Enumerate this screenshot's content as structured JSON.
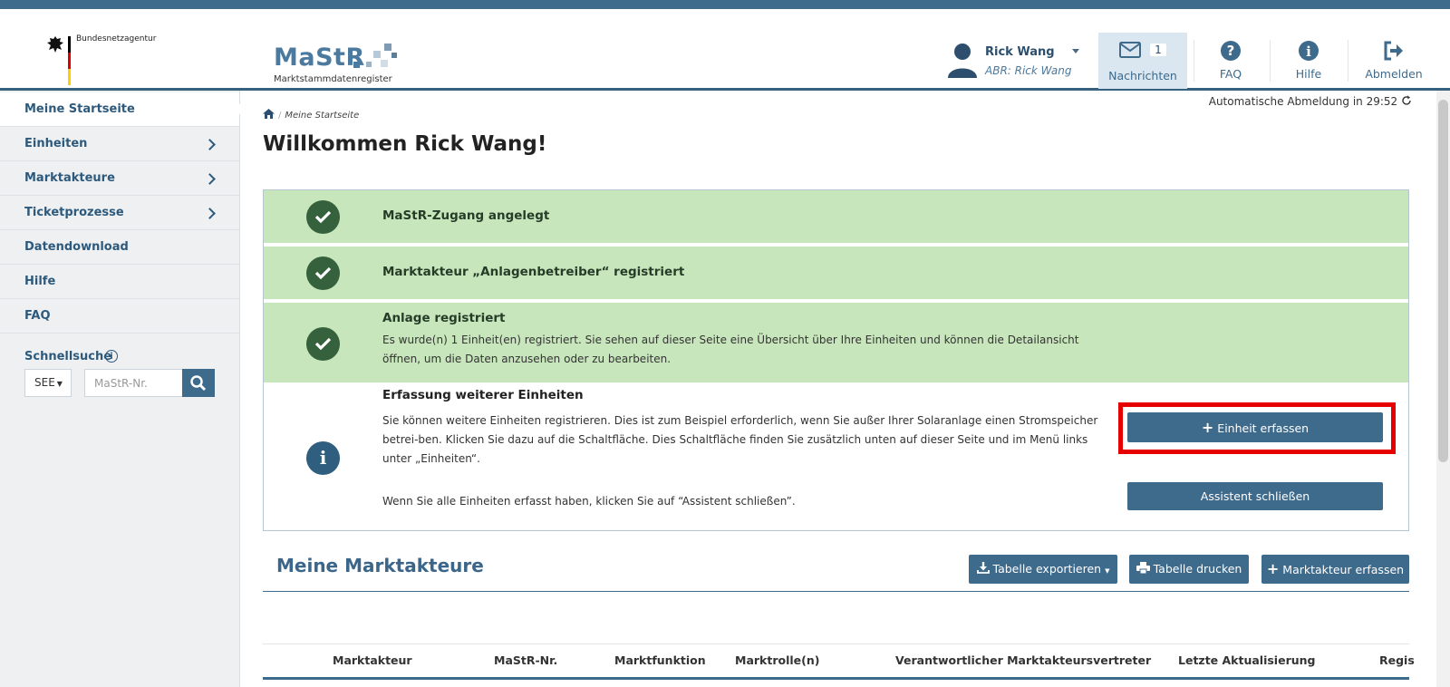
{
  "header": {
    "agency": "Bundesnetzagentur",
    "logo_title": "MaStR",
    "logo_subtitle": "Marktstammdatenregister",
    "user_name": "Rick Wang",
    "user_abr": "ABR: Rick Wang",
    "messages_label": "Nachrichten",
    "messages_count": "1",
    "faq_label": "FAQ",
    "help_label": "Hilfe",
    "logout_label": "Abmelden"
  },
  "sidebar": {
    "items": [
      {
        "label": "Meine Startseite",
        "active": true,
        "chevron": false
      },
      {
        "label": "Einheiten",
        "active": false,
        "chevron": true
      },
      {
        "label": "Marktakteure",
        "active": false,
        "chevron": true
      },
      {
        "label": "Ticketprozesse",
        "active": false,
        "chevron": true
      },
      {
        "label": "Datendownload",
        "active": false,
        "chevron": false
      },
      {
        "label": "Hilfe",
        "active": false,
        "chevron": false
      },
      {
        "label": "FAQ",
        "active": false,
        "chevron": false
      }
    ],
    "quicksearch_label": "Schnellsuche",
    "quicksearch_select": "SEE",
    "quicksearch_placeholder": "MaStR-Nr."
  },
  "breadcrumb": {
    "current": "Meine Startseite"
  },
  "auto_logout": "Automatische Abmeldung in 29:52",
  "page_title": "Willkommen Rick Wang!",
  "steps": {
    "step1_title": "MaStR-Zugang angelegt",
    "step2_title": "Marktakteur „Anlagenbetreiber“ registriert",
    "step3_title": "Anlage registriert",
    "step3_text": "Es wurde(n) 1 Einheit(en) registriert. Sie sehen auf dieser Seite eine Übersicht über Ihre Einheiten und können die Detailansicht öffnen, um die Daten anzusehen oder zu bearbeiten.",
    "step4_title": "Erfassung weiterer Einheiten",
    "step4_text": "Sie können weitere Einheiten registrieren. Dies ist zum Beispiel erforderlich, wenn Sie außer Ihrer Solaranlage einen Stromspeicher betrei-ben. Klicken Sie dazu auf die Schaltfläche. Dies Schaltfläche finden Sie zusätzlich unten auf dieser Seite und im Menü links unter „Einheiten“.",
    "step4_text2": "Wenn Sie alle Einheiten erfasst haben, klicken Sie auf “Assistent schließen”.",
    "add_unit_button": "Einheit erfassen",
    "close_assistant_button": "Assistent schließen"
  },
  "actors_section": {
    "title": "Meine Marktakteure",
    "export_button": "Tabelle exportieren",
    "print_button": "Tabelle drucken",
    "add_actor_button": "Marktakteur erfassen",
    "columns": [
      "Marktakteur",
      "MaStR-Nr.",
      "Marktfunktion",
      "Marktrolle(n)",
      "Verantwortlicher Marktakteursvertreter",
      "Letzte Aktualisierung",
      "Regis"
    ]
  },
  "colors": {
    "brand_blue": "#3e6a8c",
    "step_green": "#c8e6bc",
    "check_green": "#35613c",
    "highlight_red": "#e60000"
  }
}
